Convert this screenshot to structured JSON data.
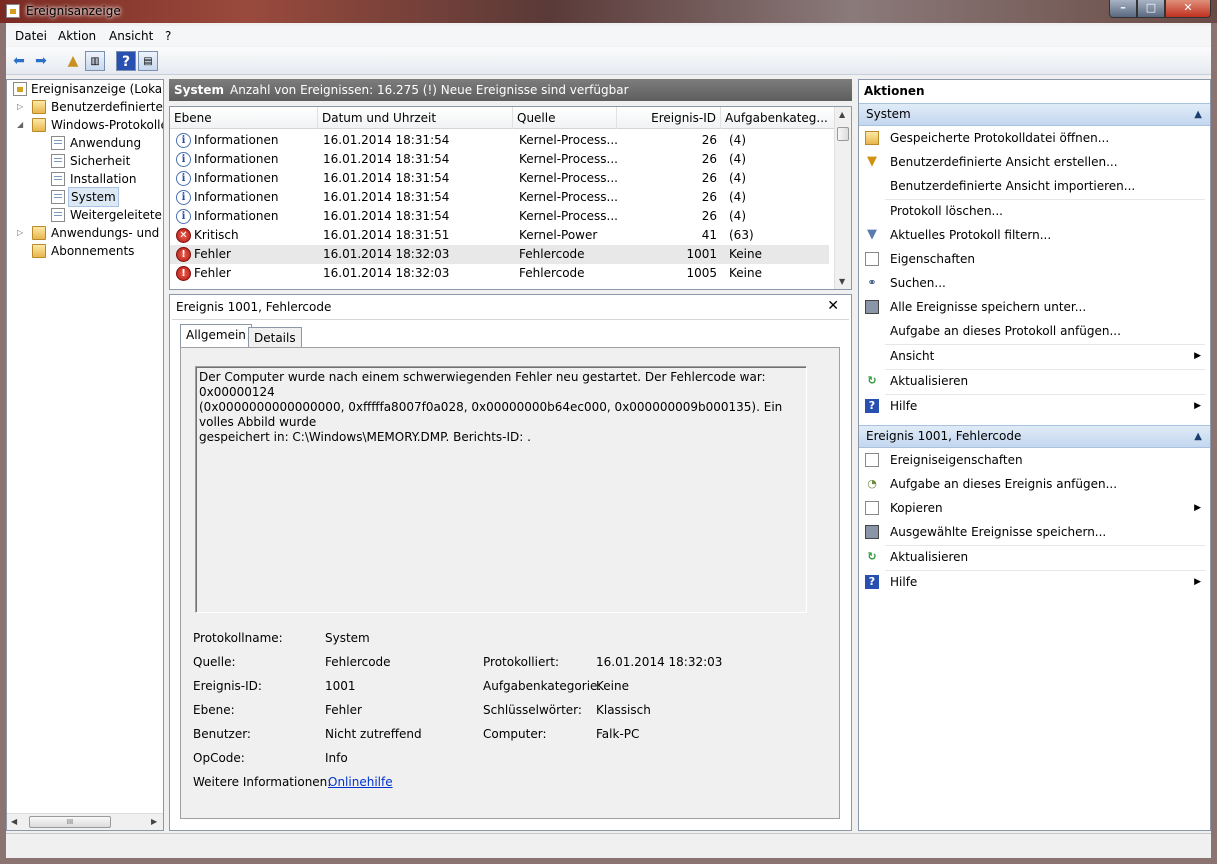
{
  "window": {
    "title": "Ereignisanzeige"
  },
  "menu": [
    "Datei",
    "Aktion",
    "Ansicht",
    "?"
  ],
  "tree": {
    "root": "Ereignisanzeige (Lokal)",
    "custom_views": "Benutzerdefinierte Ar",
    "windows_logs": "Windows-Protokolle",
    "logs": [
      "Anwendung",
      "Sicherheit",
      "Installation",
      "System",
      "Weitergeleitete Er"
    ],
    "app_logs": "Anwendungs- und Di",
    "subscriptions": "Abonnements"
  },
  "center": {
    "title": "System",
    "info": "Anzahl von Ereignissen: 16.275 (!) Neue Ereignisse sind verfügbar",
    "columns": [
      "Ebene",
      "Datum und Uhrzeit",
      "Quelle",
      "Ereignis-ID",
      "Aufgabenkateg..."
    ],
    "rows": [
      {
        "level": "Informationen",
        "type": "info",
        "date": "16.01.2014 18:31:54",
        "source": "Kernel-Process...",
        "id": "26",
        "cat": "(4)"
      },
      {
        "level": "Informationen",
        "type": "info",
        "date": "16.01.2014 18:31:54",
        "source": "Kernel-Process...",
        "id": "26",
        "cat": "(4)"
      },
      {
        "level": "Informationen",
        "type": "info",
        "date": "16.01.2014 18:31:54",
        "source": "Kernel-Process...",
        "id": "26",
        "cat": "(4)"
      },
      {
        "level": "Informationen",
        "type": "info",
        "date": "16.01.2014 18:31:54",
        "source": "Kernel-Process...",
        "id": "26",
        "cat": "(4)"
      },
      {
        "level": "Informationen",
        "type": "info",
        "date": "16.01.2014 18:31:54",
        "source": "Kernel-Process...",
        "id": "26",
        "cat": "(4)"
      },
      {
        "level": "Kritisch",
        "type": "crit",
        "date": "16.01.2014 18:31:51",
        "source": "Kernel-Power",
        "id": "41",
        "cat": "(63)"
      },
      {
        "level": "Fehler",
        "type": "err",
        "date": "16.01.2014 18:32:03",
        "source": "Fehlercode",
        "id": "1001",
        "cat": "Keine"
      },
      {
        "level": "Fehler",
        "type": "err",
        "date": "16.01.2014 18:32:03",
        "source": "Fehlercode",
        "id": "1005",
        "cat": "Keine"
      }
    ]
  },
  "detail": {
    "title": "Ereignis 1001, Fehlercode",
    "tabs": [
      "Allgemein",
      "Details"
    ],
    "description": "Der Computer wurde nach einem schwerwiegenden Fehler neu gestartet. Der Fehlercode war: 0x00000124\n(0x0000000000000000, 0xfffffa8007f0a028, 0x00000000b64ec000, 0x000000009b000135). Ein volles Abbild wurde\ngespeichert in: C:\\Windows\\MEMORY.DMP. Berichts-ID: .",
    "labels": {
      "log_name": "Protokollname:",
      "source": "Quelle:",
      "event_id": "Ereignis-ID:",
      "level": "Ebene:",
      "user": "Benutzer:",
      "opcode": "OpCode:",
      "more_info": "Weitere Informationen:",
      "logged": "Protokolliert:",
      "task_cat": "Aufgabenkategorie:",
      "keywords": "Schlüsselwörter:",
      "computer": "Computer:"
    },
    "values": {
      "log_name": "System",
      "source": "Fehlercode",
      "event_id": "1001",
      "level": "Fehler",
      "user": "Nicht zutreffend",
      "opcode": "Info",
      "more_info_link": "Onlinehilfe",
      "logged": "16.01.2014 18:32:03",
      "task_cat": "Keine",
      "keywords": "Klassisch",
      "computer": "Falk-PC"
    }
  },
  "actions": {
    "title": "Aktionen",
    "system_section": "System",
    "system_items": [
      "Gespeicherte Protokolldatei öffnen...",
      "Benutzerdefinierte Ansicht erstellen...",
      "Benutzerdefinierte Ansicht importieren...",
      "Protokoll löschen...",
      "Aktuelles Protokoll filtern...",
      "Eigenschaften",
      "Suchen...",
      "Alle Ereignisse speichern unter...",
      "Aufgabe an dieses Protokoll anfügen...",
      "Ansicht",
      "Aktualisieren",
      "Hilfe"
    ],
    "event_section": "Ereignis 1001, Fehlercode",
    "event_items": [
      "Ereigniseigenschaften",
      "Aufgabe an dieses Ereignis anfügen...",
      "Kopieren",
      "Ausgewählte Ereignisse speichern...",
      "Aktualisieren",
      "Hilfe"
    ]
  }
}
